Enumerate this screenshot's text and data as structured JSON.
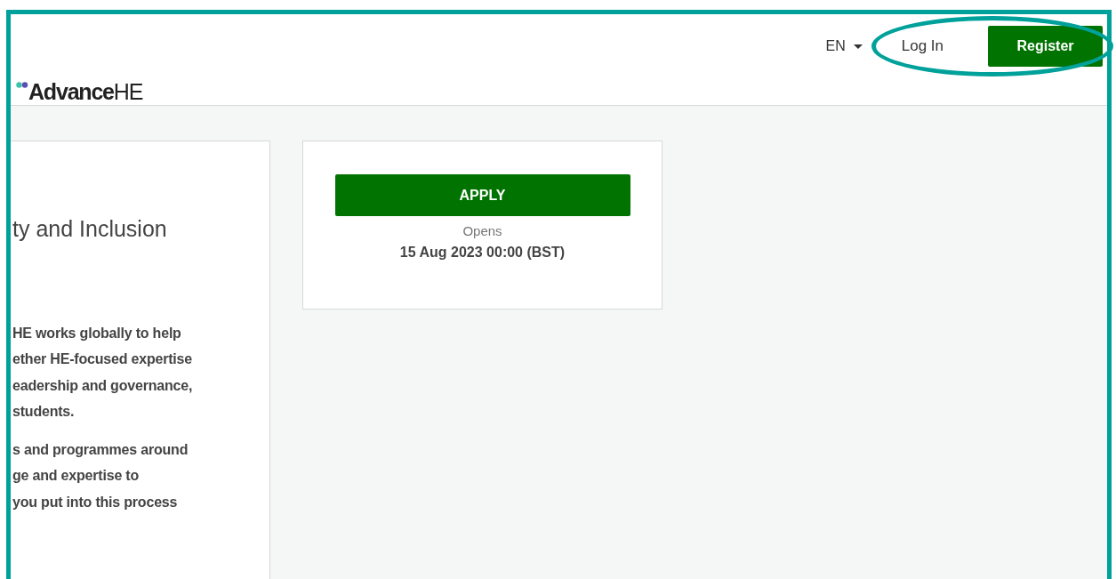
{
  "header": {
    "language": "EN",
    "login": "Log In",
    "register": "Register",
    "logo": "**Advance**HE"
  },
  "intro_card": {
    "title": "ty and Inclusion",
    "paragraphs": [
      [
        "HE works globally to help",
        "ether HE-focused expertise",
        "eadership and governance,",
        "students."
      ],
      [
        "s and programmes around",
        "ge and expertise to",
        "you put into this process"
      ]
    ]
  },
  "apply_card": {
    "button": "APPLY",
    "opens_label": "Opens",
    "opens_date": "15 Aug 2023 00:00 (BST)"
  }
}
